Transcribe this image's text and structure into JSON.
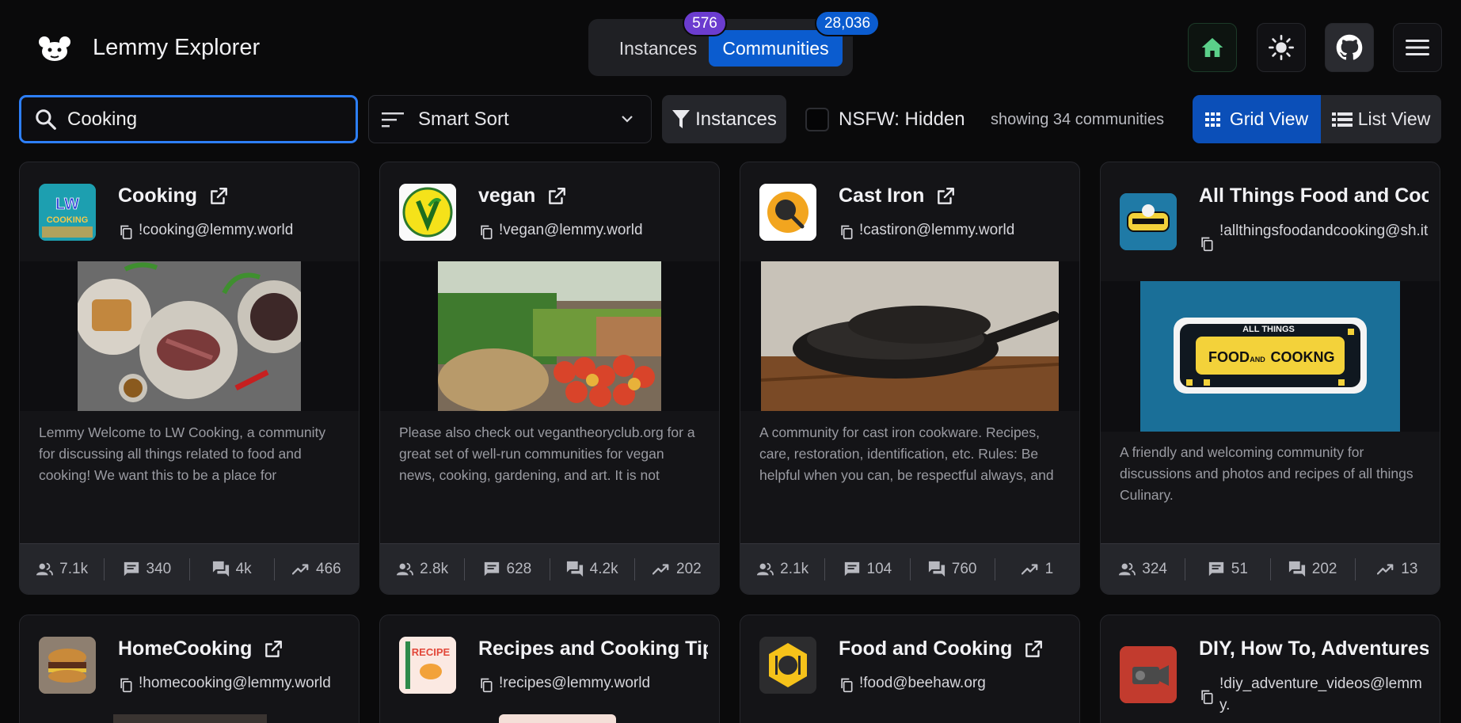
{
  "app": {
    "title": "Lemmy Explorer"
  },
  "tabs": {
    "instances": {
      "label": "Instances",
      "count": "576"
    },
    "communities": {
      "label": "Communities",
      "count": "28,036"
    }
  },
  "header_icons": [
    "home-icon",
    "sun-icon",
    "github-icon",
    "menu-icon"
  ],
  "search": {
    "value": "Cooking"
  },
  "sort": {
    "label": "Smart Sort"
  },
  "filter": {
    "label": "Instances"
  },
  "nsfw": {
    "label": "NSFW: Hidden",
    "checked": false
  },
  "showing": "showing 34 communities",
  "views": {
    "grid": "Grid View",
    "list": "List View"
  },
  "colors": {
    "accent": "#0b5ccf",
    "badge_instances": "#6b3ccf",
    "background": "#0a0a0b",
    "card": "#141417"
  },
  "communities": [
    {
      "name": "Cooking",
      "handle": "!cooking@lemmy.world",
      "avatar_text": "LW COOKING",
      "description": "Lemmy Welcome to LW Cooking, a community for discussing all things related to food and cooking! We want this to be a place for",
      "subscribers": "7.1k",
      "posts": "340",
      "comments": "4k",
      "trend": "466"
    },
    {
      "name": "vegan",
      "handle": "!vegan@lemmy.world",
      "avatar_text": "V-LABEL.EU",
      "description": "Please also check out vegantheoryclub.org for a great set of well-run communities for vegan news, cooking, gardening, and art. It is not",
      "subscribers": "2.8k",
      "posts": "628",
      "comments": "4.2k",
      "trend": "202"
    },
    {
      "name": "Cast Iron",
      "handle": "!castiron@lemmy.world",
      "description": "A community for cast iron cookware. Recipes, care, restoration, identification, etc. Rules: Be helpful when you can, be respectful always, and",
      "subscribers": "2.1k",
      "posts": "104",
      "comments": "760",
      "trend": "1"
    },
    {
      "name": "All Things Food and Coo",
      "handle": "!allthingsfoodandcooking@sh.it",
      "banner_text_1": "ALL THINGS",
      "banner_text_2": "FOOD",
      "banner_text_3": "AND",
      "banner_text_4": "COOKNG",
      "description": "A friendly and welcoming community for discussions and photos and recipes of all things Culinary.",
      "subscribers": "324",
      "posts": "51",
      "comments": "202",
      "trend": "13"
    },
    {
      "name": "HomeCooking",
      "handle": "!homecooking@lemmy.world"
    },
    {
      "name": "Recipes and Cooking Tip",
      "handle": "!recipes@lemmy.world",
      "avatar_text": "RECIPE"
    },
    {
      "name": "Food and Cooking",
      "handle": "!food@beehaw.org"
    },
    {
      "name": "DIY, How To, Adventures",
      "handle": "!diy_adventure_videos@lemmy."
    }
  ]
}
